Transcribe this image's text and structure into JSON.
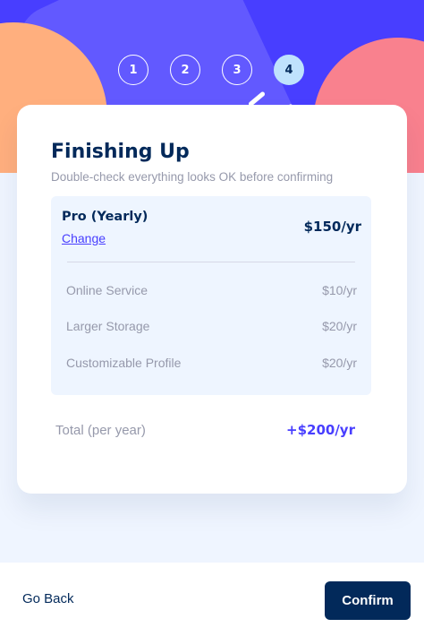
{
  "steps": [
    "1",
    "2",
    "3",
    "4"
  ],
  "active_step": 4,
  "header": {
    "title": "Finishing Up",
    "subtitle": "Double-check everything looks OK before confirming"
  },
  "plan": {
    "name": "Pro (Yearly)",
    "change_label": "Change",
    "price": "$150/yr"
  },
  "addons": [
    {
      "name": "Online Service",
      "price": "$10/yr"
    },
    {
      "name": "Larger Storage",
      "price": "$20/yr"
    },
    {
      "name": "Customizable Profile",
      "price": "$20/yr"
    }
  ],
  "total": {
    "label": "Total (per year)",
    "price": "+$200/yr"
  },
  "footer": {
    "back_label": "Go Back",
    "confirm_label": "Confirm"
  },
  "colors": {
    "marine_blue": "#02295a",
    "purplish_blue": "#483eff",
    "light_blue": "#bfe2fd",
    "cool_gray": "#9699ab",
    "magnolia": "#eff5ff"
  }
}
